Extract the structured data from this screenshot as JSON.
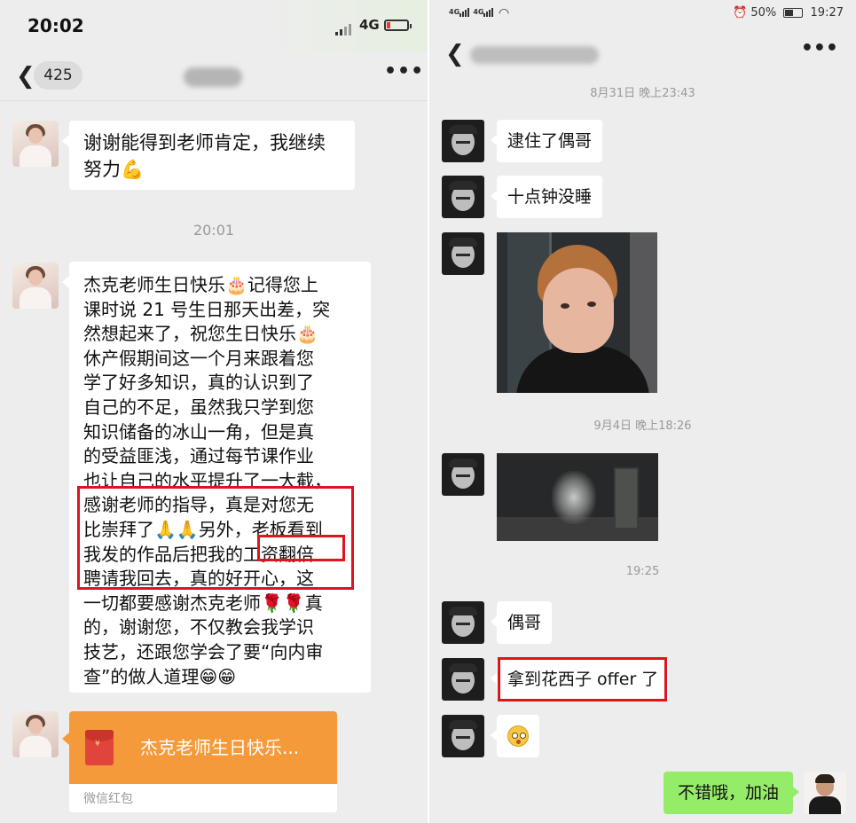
{
  "left": {
    "status": {
      "time": "20:02",
      "network": "4G"
    },
    "nav": {
      "badge_count": "425"
    },
    "messages": [
      {
        "text": "谢谢能得到老师肯定，我继续\n努力💪"
      },
      {
        "text": "杰克老师生日快乐🎂记得您上\n课时说 21 号生日那天出差，突\n然想起来了，祝您生日快乐🎂\n休产假期间这一个月来跟着您\n学了好多知识，真的认识到了\n自己的不足，虽然我只学到您\n知识储备的冰山一角，但是真\n的受益匪浅，通过每节课作业\n也让自己的水平提升了一大截，\n感谢老师的指导，真是对您无\n比崇拜了🙏🙏另外，老板看到\n我发的作品后把我的工资翻倍\n聘请我回去，真的好开心，这\n一切都要感谢杰克老师🌹🌹真\n的，谢谢您，不仅教会我学识\n技艺，还跟您学会了要“向内审\n查”的做人道理😁😁"
      }
    ],
    "timestamp": "20:01",
    "red_packet": {
      "title": "杰克老师生日快乐...",
      "footer": "微信红包"
    }
  },
  "right": {
    "status": {
      "signal": "4G 4G",
      "battery": "50%",
      "time": "19:27"
    },
    "timestamps": [
      "8月31日 晚上23:43",
      "9月4日 晚上18:26",
      "19:25"
    ],
    "messages": [
      "逮住了偶哥",
      "十点钟没睡",
      "偶哥",
      "拿到花西子 offer 了"
    ],
    "my_message": "不错哦，加油"
  }
}
